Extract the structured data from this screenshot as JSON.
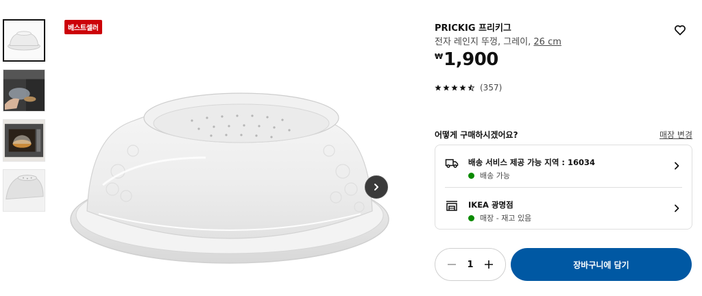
{
  "product": {
    "badge": "베스트셀러",
    "name": "PRICKIG 프리키그",
    "description": "전자 레인지 뚜껑, 그레이,",
    "size": "26 cm",
    "currency": "₩",
    "price": "1,900",
    "rating": 4.5,
    "review_count": "(357)"
  },
  "thumbnails": [
    {
      "icon": "lid-product-thumbnail",
      "selected": true
    },
    {
      "icon": "lid-in-use-thumbnail",
      "selected": false
    },
    {
      "icon": "lid-in-oven-thumbnail",
      "selected": false
    },
    {
      "icon": "lid-closeup-thumbnail",
      "selected": false
    }
  ],
  "purchase": {
    "question": "어떻게 구매하시겠어요?",
    "change_store": "매장 변경",
    "delivery": {
      "title": "배송 서비스 제공 가능 지역 : 16034",
      "status": "배송 가능"
    },
    "store": {
      "title": "IKEA 광명점",
      "status": "매장 - 재고 있음"
    }
  },
  "quantity": "1",
  "add_to_cart": "장바구니에 담기",
  "colors": {
    "badge": "#cc0008",
    "cart_button": "#0058a3",
    "available_dot": "#0a8a00"
  }
}
